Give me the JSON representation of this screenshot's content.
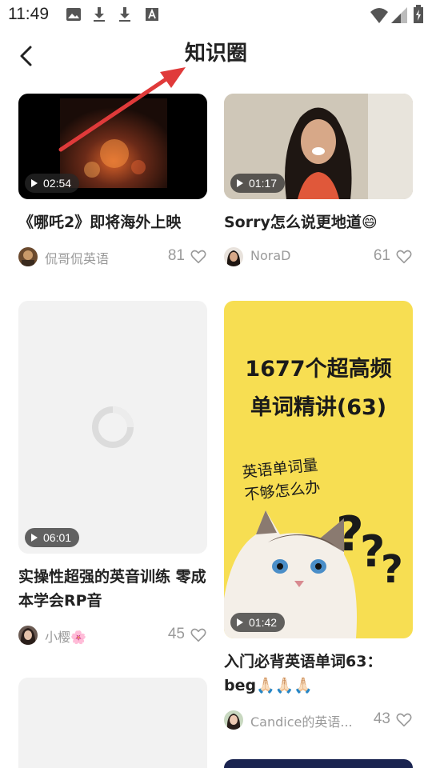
{
  "status": {
    "time": "11:49"
  },
  "header": {
    "title": "知识圈"
  },
  "cards": [
    {
      "title": "《哪吒2》即将海外上映",
      "duration": "02:54",
      "author": "侃哥侃英语",
      "likes": "81"
    },
    {
      "title": "Sorry怎么说更地道😄",
      "duration": "01:17",
      "author": "NoraD",
      "likes": "61"
    },
    {
      "title": "实操性超强的英音训练 零成本学会RP音",
      "duration": "06:01",
      "author": "小樱🌸",
      "likes": "45"
    },
    {
      "title": "入门必背英语单词63：beg🙏🏻🙏🏻🙏🏻",
      "duration": "01:42",
      "author": "Candice的英语...",
      "likes": "43",
      "poster_line1": "1677个超高频",
      "poster_line2": "单词精讲(63)",
      "poster_sub1": "英语单词量",
      "poster_sub2": "不够怎么办",
      "poster_bg": "#f7de52"
    }
  ],
  "annotation_color": "#e03a3a"
}
